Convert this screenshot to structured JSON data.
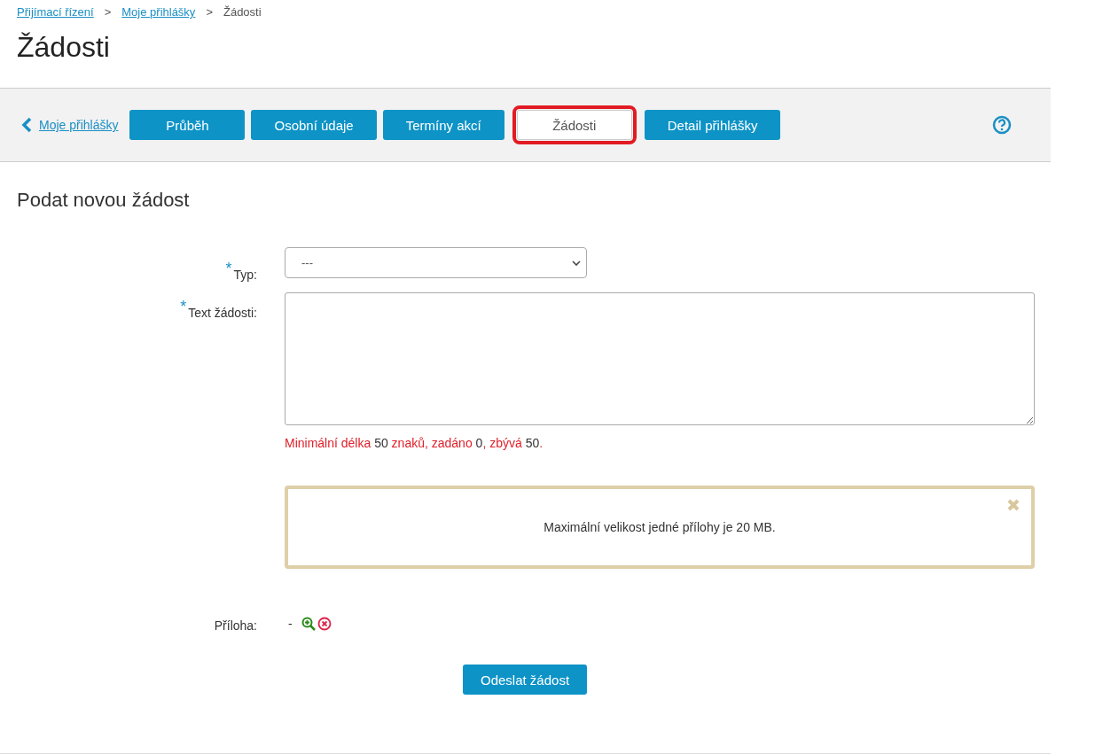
{
  "breadcrumb": [
    {
      "label": "Přijímací řízení",
      "kind": "link"
    },
    {
      "label": "Moje přihlášky",
      "kind": "link"
    },
    {
      "label": "Žádosti",
      "kind": "current"
    }
  ],
  "separator": ">",
  "title": "Žádosti",
  "nav": {
    "back": "Moje přihlášky",
    "tabs": [
      {
        "label": "Průběh",
        "selected": false
      },
      {
        "label": "Osobní údaje",
        "selected": false
      },
      {
        "label": "Termíny akcí",
        "selected": false
      },
      {
        "label": "Žádosti",
        "selected": true
      },
      {
        "label": "Detail přihlášky",
        "selected": false
      }
    ]
  },
  "section_title": "Podat novou žádost",
  "form": {
    "type": {
      "label": "Typ:",
      "required_mark": "*",
      "value": "---"
    },
    "text": {
      "label": "Text žádosti:",
      "required_mark": "*"
    },
    "counter": [
      {
        "text": "Minimální délka ",
        "kind": "label"
      },
      {
        "text": "50",
        "kind": "value"
      },
      {
        "text": " znaků, zadáno ",
        "kind": "label"
      },
      {
        "text": "0",
        "kind": "value"
      },
      {
        "text": ", zbývá ",
        "kind": "label"
      },
      {
        "text": "50",
        "kind": "value"
      },
      {
        "text": ".",
        "kind": "label"
      }
    ],
    "notice": "Maximální velikost jedné přílohy je 20 MB.",
    "attachment": {
      "label": "Příloha:",
      "value": "-"
    },
    "submit": "Odeslat žádost"
  }
}
